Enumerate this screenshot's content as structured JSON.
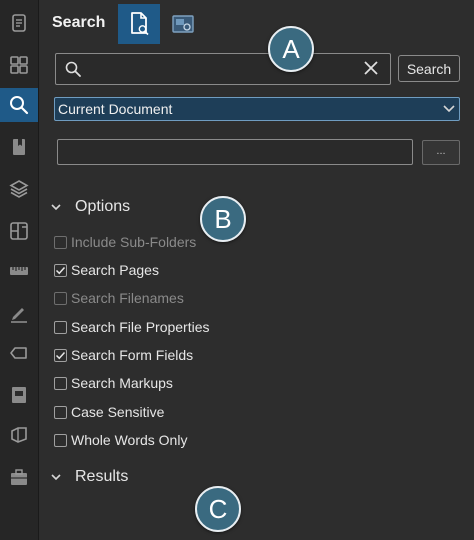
{
  "sidebar": {
    "items": [
      {
        "icon": "document-properties-icon",
        "active": false
      },
      {
        "icon": "thumbnails-icon",
        "active": false
      },
      {
        "icon": "search-icon",
        "active": true
      },
      {
        "icon": "bookmarks-icon",
        "active": false
      },
      {
        "icon": "layers-icon",
        "active": false
      },
      {
        "icon": "spaces-icon",
        "active": false
      },
      {
        "icon": "measurements-icon",
        "active": false
      },
      {
        "icon": "signatures-icon",
        "active": false
      },
      {
        "icon": "links-icon",
        "active": false
      },
      {
        "icon": "markups-list-icon",
        "active": false
      },
      {
        "icon": "sets-icon",
        "active": false
      },
      {
        "icon": "toolchest-icon",
        "active": false
      }
    ]
  },
  "panel": {
    "title": "Search",
    "modes": [
      {
        "icon": "text-search-icon",
        "active": true
      },
      {
        "icon": "visual-search-icon",
        "active": false
      }
    ]
  },
  "search": {
    "query": "",
    "button_label": "Search",
    "scope": "Current Document",
    "folder_path": "",
    "browse_label": "..."
  },
  "sections": {
    "options_label": "Options",
    "results_label": "Results"
  },
  "options": [
    {
      "label": "Include Sub-Folders",
      "checked": false,
      "enabled": false
    },
    {
      "label": "Search Pages",
      "checked": true,
      "enabled": true
    },
    {
      "label": "Search Filenames",
      "checked": false,
      "enabled": false
    },
    {
      "label": "Search File Properties",
      "checked": false,
      "enabled": true
    },
    {
      "label": "Search Form Fields",
      "checked": true,
      "enabled": true
    },
    {
      "label": "Search Markups",
      "checked": false,
      "enabled": true
    },
    {
      "label": "Case Sensitive",
      "checked": false,
      "enabled": true
    },
    {
      "label": "Whole Words Only",
      "checked": false,
      "enabled": true
    }
  ],
  "callouts": {
    "a": "A",
    "b": "B",
    "c": "C"
  },
  "colors": {
    "accent": "#1f5a88",
    "panel_bg": "#2d2d2d",
    "callout": "#3a6a80"
  }
}
